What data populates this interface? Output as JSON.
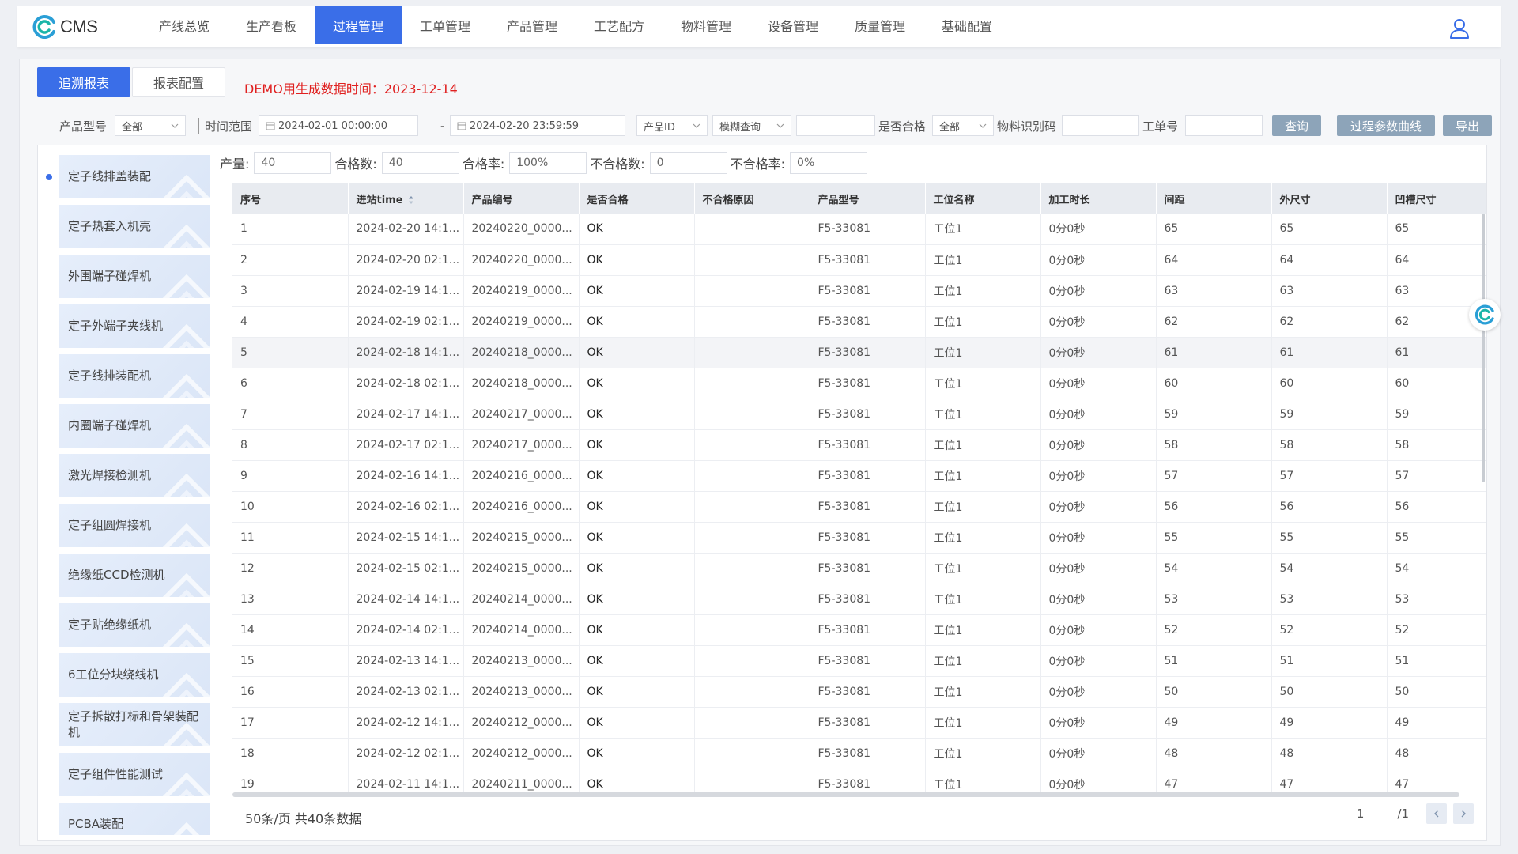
{
  "app": {
    "logo_text": "CMS"
  },
  "nav": {
    "items": [
      "产线总览",
      "生产看板",
      "过程管理",
      "工单管理",
      "产品管理",
      "工艺配方",
      "物料管理",
      "设备管理",
      "质量管理",
      "基础配置"
    ],
    "active_index": 2
  },
  "subtabs": {
    "active": "追溯报表",
    "inactive": "报表配置"
  },
  "demo_note": "DEMO用生成数据时间：2023-12-14",
  "filters": {
    "product_model_label": "产品型号",
    "product_model_value": "全部",
    "time_range_label": "时间范围",
    "start_time": "2024-02-01 00:00:00",
    "dash": "-",
    "end_time": "2024-02-20 23:59:59",
    "product_id_select": "产品ID",
    "fuzzy_select": "模糊查询",
    "qualified_label": "是否合格",
    "qualified_value": "全部",
    "material_code_label": "物料识别码",
    "work_order_label": "工单号",
    "query_button": "查询",
    "curve_button": "过程参数曲线",
    "export_button": "导出"
  },
  "stations": [
    "定子线排盖装配",
    "定子热套入机壳",
    "外围端子碰焊机",
    "定子外端子夹线机",
    "定子线排装配机",
    "内圈端子碰焊机",
    "激光焊接检测机",
    "定子组圆焊接机",
    "绝缘纸CCD检测机",
    "定子贴绝缘纸机",
    "6工位分块绕线机",
    "定子拆散打标和骨架装配机",
    "定子组件性能测试",
    "PCBA装配"
  ],
  "stats": {
    "output_label": "产量:",
    "output_value": "40",
    "pass_count_label": "合格数:",
    "pass_count_value": "40",
    "pass_rate_label": "合格率:",
    "pass_rate_value": "100%",
    "fail_count_label": "不合格数:",
    "fail_count_value": "0",
    "fail_rate_label": "不合格率:",
    "fail_rate_value": "0%"
  },
  "table": {
    "columns": [
      "序号",
      "进站time",
      "产品编号",
      "是否合格",
      "不合格原因",
      "产品型号",
      "工位名称",
      "加工时长",
      "间距",
      "外尺寸",
      "凹槽尺寸"
    ],
    "rows": [
      [
        "1",
        "2024-02-20 14:1...",
        "20240220_0000...",
        "OK",
        "",
        "F5-33081",
        "工位1",
        "0分0秒",
        "65",
        "65",
        "65"
      ],
      [
        "2",
        "2024-02-20 02:1...",
        "20240220_0000...",
        "OK",
        "",
        "F5-33081",
        "工位1",
        "0分0秒",
        "64",
        "64",
        "64"
      ],
      [
        "3",
        "2024-02-19 14:1...",
        "20240219_0000...",
        "OK",
        "",
        "F5-33081",
        "工位1",
        "0分0秒",
        "63",
        "63",
        "63"
      ],
      [
        "4",
        "2024-02-19 02:1...",
        "20240219_0000...",
        "OK",
        "",
        "F5-33081",
        "工位1",
        "0分0秒",
        "62",
        "62",
        "62"
      ],
      [
        "5",
        "2024-02-18 14:1...",
        "20240218_0000...",
        "OK",
        "",
        "F5-33081",
        "工位1",
        "0分0秒",
        "61",
        "61",
        "61"
      ],
      [
        "6",
        "2024-02-18 02:1...",
        "20240218_0000...",
        "OK",
        "",
        "F5-33081",
        "工位1",
        "0分0秒",
        "60",
        "60",
        "60"
      ],
      [
        "7",
        "2024-02-17 14:1...",
        "20240217_0000...",
        "OK",
        "",
        "F5-33081",
        "工位1",
        "0分0秒",
        "59",
        "59",
        "59"
      ],
      [
        "8",
        "2024-02-17 02:1...",
        "20240217_0000...",
        "OK",
        "",
        "F5-33081",
        "工位1",
        "0分0秒",
        "58",
        "58",
        "58"
      ],
      [
        "9",
        "2024-02-16 14:1...",
        "20240216_0000...",
        "OK",
        "",
        "F5-33081",
        "工位1",
        "0分0秒",
        "57",
        "57",
        "57"
      ],
      [
        "10",
        "2024-02-16 02:1...",
        "20240216_0000...",
        "OK",
        "",
        "F5-33081",
        "工位1",
        "0分0秒",
        "56",
        "56",
        "56"
      ],
      [
        "11",
        "2024-02-15 14:1...",
        "20240215_0000...",
        "OK",
        "",
        "F5-33081",
        "工位1",
        "0分0秒",
        "55",
        "55",
        "55"
      ],
      [
        "12",
        "2024-02-15 02:1...",
        "20240215_0000...",
        "OK",
        "",
        "F5-33081",
        "工位1",
        "0分0秒",
        "54",
        "54",
        "54"
      ],
      [
        "13",
        "2024-02-14 14:1...",
        "20240214_0000...",
        "OK",
        "",
        "F5-33081",
        "工位1",
        "0分0秒",
        "53",
        "53",
        "53"
      ],
      [
        "14",
        "2024-02-14 02:1...",
        "20240214_0000...",
        "OK",
        "",
        "F5-33081",
        "工位1",
        "0分0秒",
        "52",
        "52",
        "52"
      ],
      [
        "15",
        "2024-02-13 14:1...",
        "20240213_0000...",
        "OK",
        "",
        "F5-33081",
        "工位1",
        "0分0秒",
        "51",
        "51",
        "51"
      ],
      [
        "16",
        "2024-02-13 02:1...",
        "20240213_0000...",
        "OK",
        "",
        "F5-33081",
        "工位1",
        "0分0秒",
        "50",
        "50",
        "50"
      ],
      [
        "17",
        "2024-02-12 14:1...",
        "20240212_0000...",
        "OK",
        "",
        "F5-33081",
        "工位1",
        "0分0秒",
        "49",
        "49",
        "49"
      ],
      [
        "18",
        "2024-02-12 02:1...",
        "20240212_0000...",
        "OK",
        "",
        "F5-33081",
        "工位1",
        "0分0秒",
        "48",
        "48",
        "48"
      ],
      [
        "19",
        "2024-02-11 14:1...",
        "20240211_0000...",
        "OK",
        "",
        "F5-33081",
        "工位1",
        "0分0秒",
        "47",
        "47",
        "47"
      ]
    ],
    "highlight_row": 4
  },
  "footer": {
    "page_info": "50条/页 共40条数据",
    "current_page": "1",
    "total_pages": "/1"
  },
  "colors": {
    "primary": "#3a6ee8",
    "demo_red": "#e02020",
    "button_gray": "#8da4b9"
  }
}
